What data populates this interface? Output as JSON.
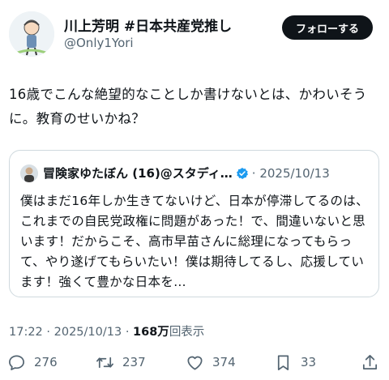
{
  "author": {
    "name": "川上芳明 #日本共産党推し",
    "handle": "@Only1Yori",
    "avatar_icon": "avatar-illustration-icon"
  },
  "follow_button": {
    "label": "フォローする"
  },
  "tweet": {
    "text": "16歳でこんな絶望的なことしか書けないとは、かわいそうに。教育のせいかね？"
  },
  "quote": {
    "author_name": "冒険家ゆたぼん (16)@スタディ…",
    "verified_icon": "verified-badge-icon",
    "date": "2025/10/13",
    "text": "僕はまだ16年しか生きてないけど、日本が停滞してるのは、これまでの自民党政権に問題があった！で、間違いないと思います！だからこそ、高市早苗さんに総理になってもらって、やり遂げてもらいたい！僕は期待してるし、応援しています！強くて豊かな日本を…"
  },
  "meta": {
    "time": "17:22",
    "separator": "·",
    "date": "2025/10/13",
    "separator2": "·",
    "views": "168万",
    "views_label": "回表示"
  },
  "actions": {
    "reply": {
      "icon": "reply-icon",
      "count": "276"
    },
    "retweet": {
      "icon": "retweet-icon",
      "count": "237"
    },
    "like": {
      "icon": "heart-icon",
      "count": "374"
    },
    "bookmark": {
      "icon": "bookmark-icon",
      "count": "33"
    },
    "share": {
      "icon": "share-icon"
    }
  },
  "colors": {
    "text": "#0f1419",
    "secondary": "#536471",
    "verified": "#1d9bf0",
    "border": "#cfd9de"
  }
}
